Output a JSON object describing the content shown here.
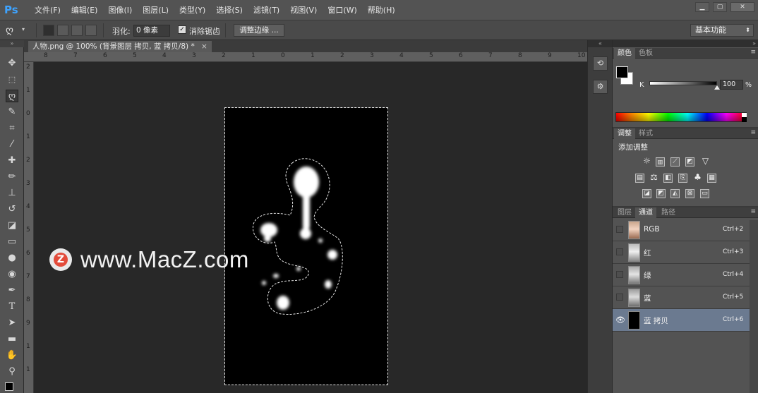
{
  "app": {
    "logo": "Ps"
  },
  "menu": [
    "文件(F)",
    "编辑(E)",
    "图像(I)",
    "图层(L)",
    "类型(Y)",
    "选择(S)",
    "滤镜(T)",
    "视图(V)",
    "窗口(W)",
    "帮助(H)"
  ],
  "window_controls": {
    "minimize": "▁",
    "restore": "▢",
    "close": "✕"
  },
  "options": {
    "feather_label": "羽化:",
    "feather_value": "0 像素",
    "antialias_label": "消除锯齿",
    "antialias_checked": true,
    "refine_edge_label": "调整边缘 ...",
    "workspace": "基本功能"
  },
  "document": {
    "tab_title": "人物.png @ 100% (背景图层 拷贝, 蓝 拷贝/8) *",
    "close": "×"
  },
  "rulers": {
    "top": [
      "8",
      "7",
      "6",
      "5",
      "4",
      "3",
      "2",
      "1",
      "0",
      "1",
      "2",
      "3",
      "4",
      "5",
      "6",
      "7",
      "8",
      "9",
      "10"
    ],
    "left": [
      "2",
      "1",
      "0",
      "1",
      "2",
      "3",
      "4",
      "5",
      "6",
      "7",
      "8",
      "9",
      "1",
      "1"
    ]
  },
  "watermark": {
    "badge": "Z",
    "text": "www.MacZ.com"
  },
  "panels": {
    "color": {
      "tabs": [
        "颜色",
        "色板"
      ],
      "active_tab": "颜色",
      "channel_label": "K",
      "value": "100",
      "unit": "%",
      "foreground": "#000000",
      "background": "#ffffff"
    },
    "adjustments": {
      "tabs": [
        "调整",
        "样式"
      ],
      "active_tab": "调整",
      "heading": "添加调整"
    },
    "channels": {
      "tabs": [
        "图层",
        "通道",
        "路径"
      ],
      "active_tab": "通道",
      "rows": [
        {
          "name": "RGB",
          "shortcut": "Ctrl+2",
          "selected": false,
          "visible": false
        },
        {
          "name": "红",
          "shortcut": "Ctrl+3",
          "selected": false,
          "visible": false
        },
        {
          "name": "绿",
          "shortcut": "Ctrl+4",
          "selected": false,
          "visible": false
        },
        {
          "name": "蓝",
          "shortcut": "Ctrl+5",
          "selected": false,
          "visible": false
        },
        {
          "name": "蓝 拷贝",
          "shortcut": "Ctrl+6",
          "selected": true,
          "visible": true
        }
      ]
    }
  },
  "colors": {
    "accent": "#3ea3ff",
    "selection": "#6b7a90",
    "chrome": "#535353"
  }
}
